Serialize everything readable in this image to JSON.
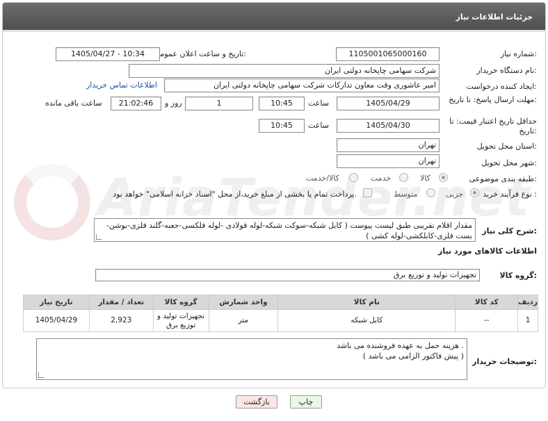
{
  "header": {
    "title": "جزئیات اطلاعات نیاز"
  },
  "fields": {
    "need_number": {
      "label": "شماره نیاز:",
      "value": "1105001065000160"
    },
    "announce_datetime": {
      "label": "تاریخ و ساعت اعلان عمومی:",
      "value": "1405/04/27 - 10:34"
    },
    "buyer_org": {
      "label": "نام دستگاه خریدار:",
      "value": "شرکت سهامی چاپخانه دولتی ایران"
    },
    "requester": {
      "label": "ایجاد کننده درخواست:",
      "value": "امیر عاشوری وقت معاون تدارکات شرکت سهامی چاپخانه دولتی ایران",
      "contact_link": "اطلاعات تماس خریدار"
    },
    "reply_deadline": {
      "label": "مهلت ارسال پاسخ: تا تاریخ:",
      "date": "1405/04/29",
      "time_label": "ساعت",
      "time": "10:45",
      "days": "1",
      "days_label": "روز و",
      "remaining": "21:02:46",
      "remaining_label": "ساعت باقی مانده"
    },
    "price_validity": {
      "label": "حداقل تاریخ اعتبار قیمت: تا تاریخ:",
      "date": "1405/04/30",
      "time_label": "ساعت",
      "time": "10:45"
    },
    "delivery_province": {
      "label": "استان محل تحویل:",
      "value": "تهران"
    },
    "delivery_city": {
      "label": "شهر محل تحویل:",
      "value": "تهران"
    },
    "category": {
      "label": "طبقه بندی موضوعی:",
      "options": [
        "کالا",
        "خدمت",
        "کالا/خدمت"
      ],
      "selected": "کالا"
    },
    "process": {
      "label": "نوع فرآیند خرید :",
      "options": [
        "جزیی",
        "متوسط"
      ],
      "selected": "جزیی",
      "payment_note": "پرداخت تمام یا بخشی از مبلغ خرید،از محل \"اسناد خزانه اسلامی\" خواهد بود."
    },
    "description": {
      "label": "شرح کلی نیاز:",
      "value": "مقدار اقلام تقریبی طبق لیست پیوست ( کابل شبکه-سوکت شبکه-لوله فولادی -لوله فلکسی-جعبه-گلند فلزی-بوشن-بست فلزی-کابلکشی-لوله کشی )"
    },
    "goods_info_title": "اطلاعات کالاهای مورد نیاز",
    "goods_group": {
      "label": "گروه کالا:",
      "value": "تجهیزات تولید و توزیع برق"
    }
  },
  "table": {
    "headers": [
      "ردیف",
      "کد کالا",
      "نام کالا",
      "واحد شمارش",
      "گروه کالا",
      "تعداد / مقدار",
      "تاریخ نیاز"
    ],
    "rows": [
      {
        "row": "1",
        "code": "--",
        "name": "کابل شبکه",
        "unit": "متر",
        "group": "تجهیزات تولید و توزیع برق",
        "qty": "2,923",
        "date": "1405/04/29"
      }
    ]
  },
  "buyer_notes": {
    "label": "توضیحات خریدار:",
    "line1": "هزینه حمل به عهده فروشنده می باشد .",
    "line2": "( پیش فاکتور الزامی می باشد )"
  },
  "buttons": {
    "print": "چاپ",
    "back": "بازگشت"
  },
  "watermark": "AriaTender.net",
  "colors": {
    "header_bg": "#5a5a5a",
    "link": "#1c4fa8",
    "table_header": "#d8d8d8",
    "print_btn": "#e9f7e4",
    "back_btn": "#fbe6e6"
  }
}
